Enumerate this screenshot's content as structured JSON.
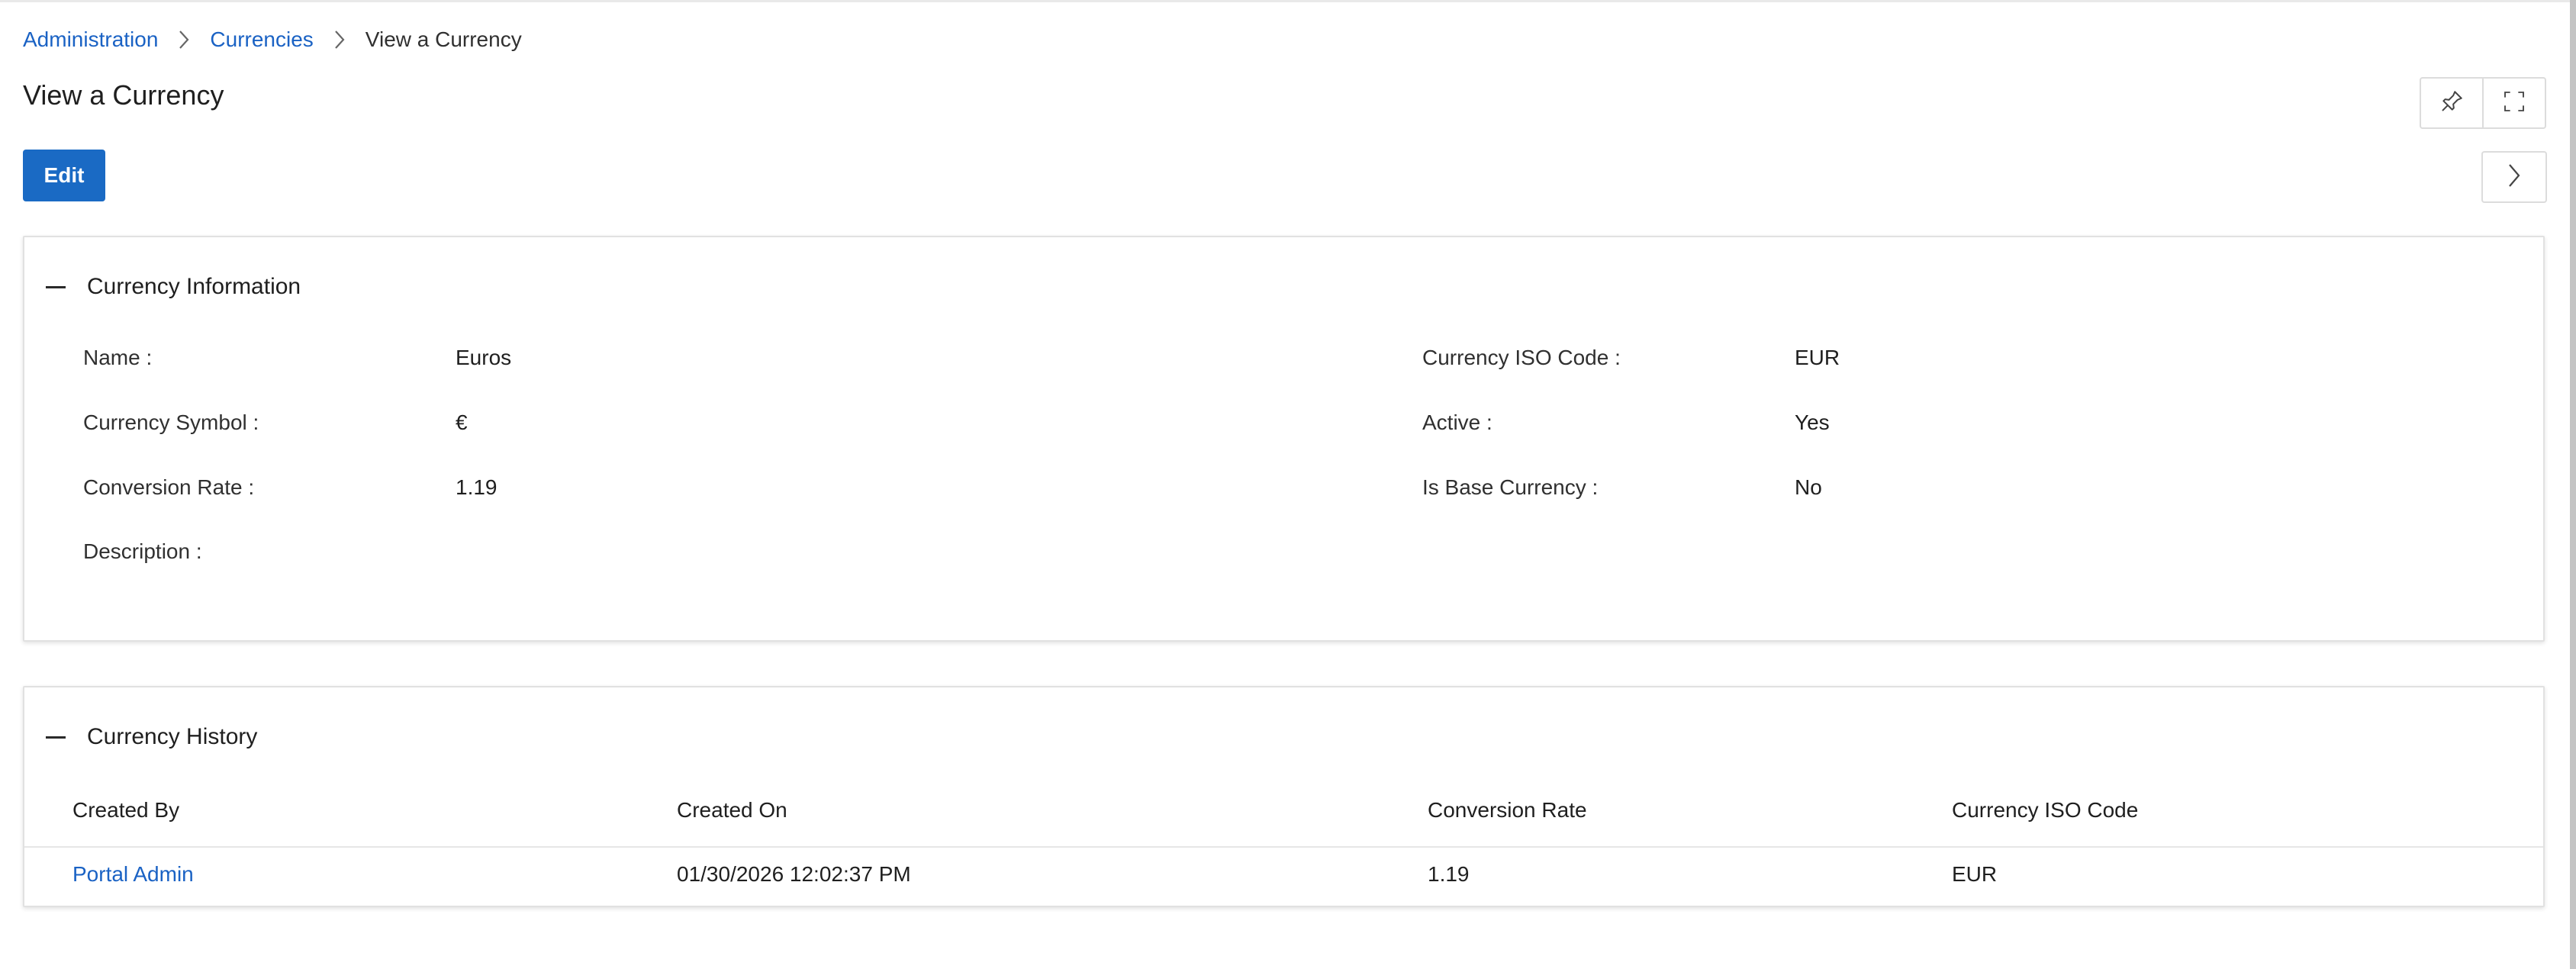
{
  "breadcrumb": {
    "items": [
      {
        "label": "Administration"
      },
      {
        "label": "Currencies"
      }
    ],
    "current": "View a Currency"
  },
  "page": {
    "title": "View a Currency",
    "edit_label": "Edit"
  },
  "toolbar": {
    "pin_icon": "pin-icon",
    "fullscreen_icon": "fullscreen-icon",
    "next_icon": "chevron-right-icon"
  },
  "info": {
    "title": "Currency Information",
    "fields": {
      "name": {
        "label": "Name :",
        "value": "Euros"
      },
      "symbol": {
        "label": "Currency Symbol :",
        "value": "€"
      },
      "rate": {
        "label": "Conversion Rate :",
        "value": "1.19"
      },
      "description": {
        "label": "Description :",
        "value": ""
      },
      "iso": {
        "label": "Currency ISO Code :",
        "value": "EUR"
      },
      "active": {
        "label": "Active :",
        "value": "Yes"
      },
      "base": {
        "label": "Is Base Currency :",
        "value": "No"
      }
    }
  },
  "history": {
    "title": "Currency History",
    "columns": [
      "Created By",
      "Created On",
      "Conversion Rate",
      "Currency ISO Code"
    ],
    "rows": [
      {
        "created_by": "Portal Admin",
        "created_on": "01/30/2026 12:02:37 PM",
        "rate": "1.19",
        "iso": "EUR"
      }
    ]
  },
  "colors": {
    "accent": "#1a6ac4",
    "link": "#1a62c4"
  }
}
